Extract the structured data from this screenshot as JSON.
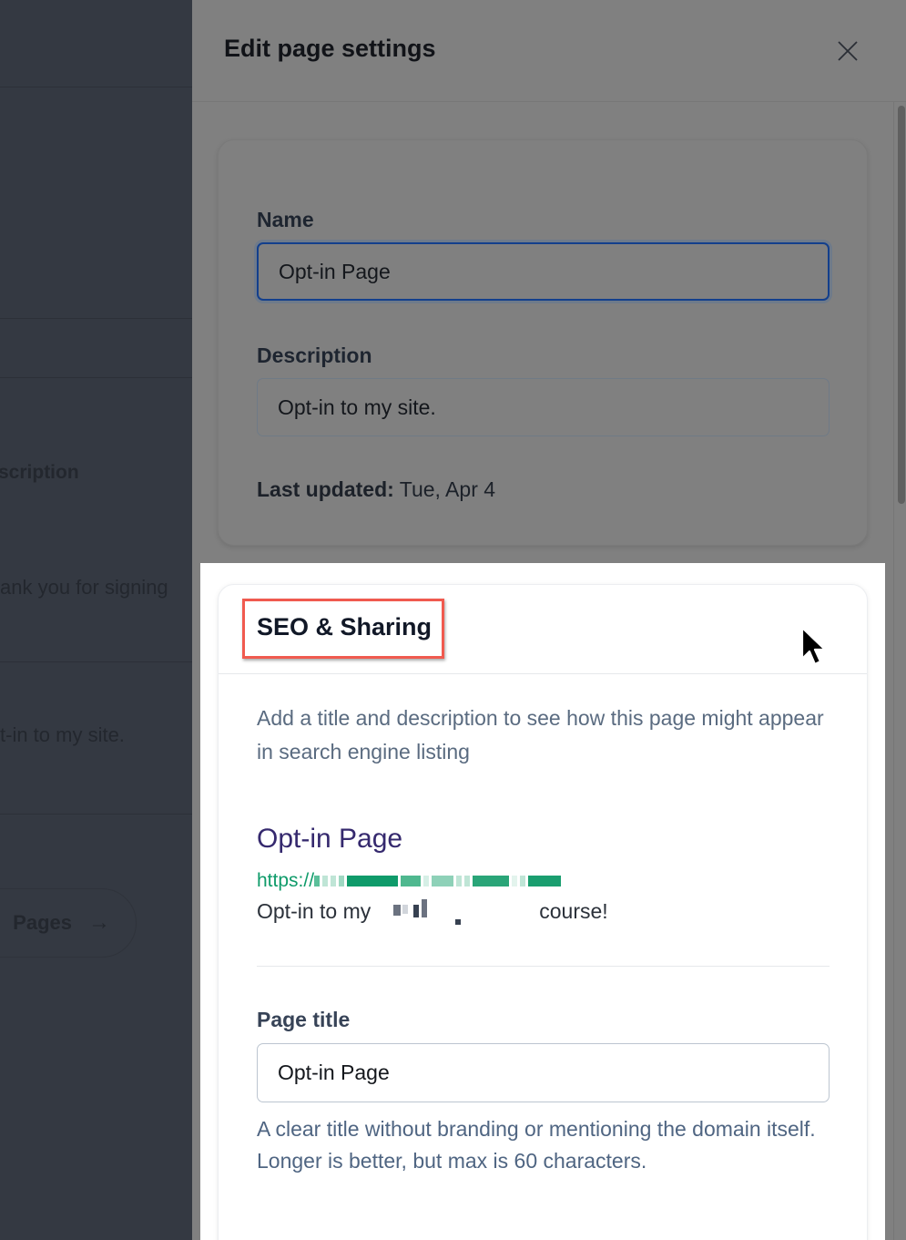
{
  "background_page": {
    "partial_texts": {
      "description_header": "scription",
      "thank_you_text": "ank you for signing",
      "description_value": "t-in to my site.",
      "pages_button": "Pages"
    }
  },
  "drawer": {
    "title": "Edit page settings",
    "close_icon": "close-icon",
    "general": {
      "name_label": "Name",
      "name_value": "Opt-in Page",
      "description_label": "Description",
      "description_value": "Opt-in to my site.",
      "last_updated_label": "Last updated:",
      "last_updated_value": "Tue, Apr 4"
    },
    "seo": {
      "title": "SEO & Sharing",
      "intro": "Add a title and description to see how this page might appear in search engine listing",
      "preview": {
        "title": "Opt-in Page",
        "url_prefix": "https://",
        "description_prefix": "Opt-in to my",
        "description_suffix": "course!"
      },
      "page_title_label": "Page title",
      "page_title_value": "Opt-in Page",
      "page_title_helper": "A clear title without branding or mentioning the domain itself. Longer is better, but max is 60 characters."
    }
  },
  "colors": {
    "highlight_box": "#f05a4f",
    "preview_title": "#35296e",
    "preview_url": "#0f9b6a",
    "focus_border": "#133f8c"
  }
}
